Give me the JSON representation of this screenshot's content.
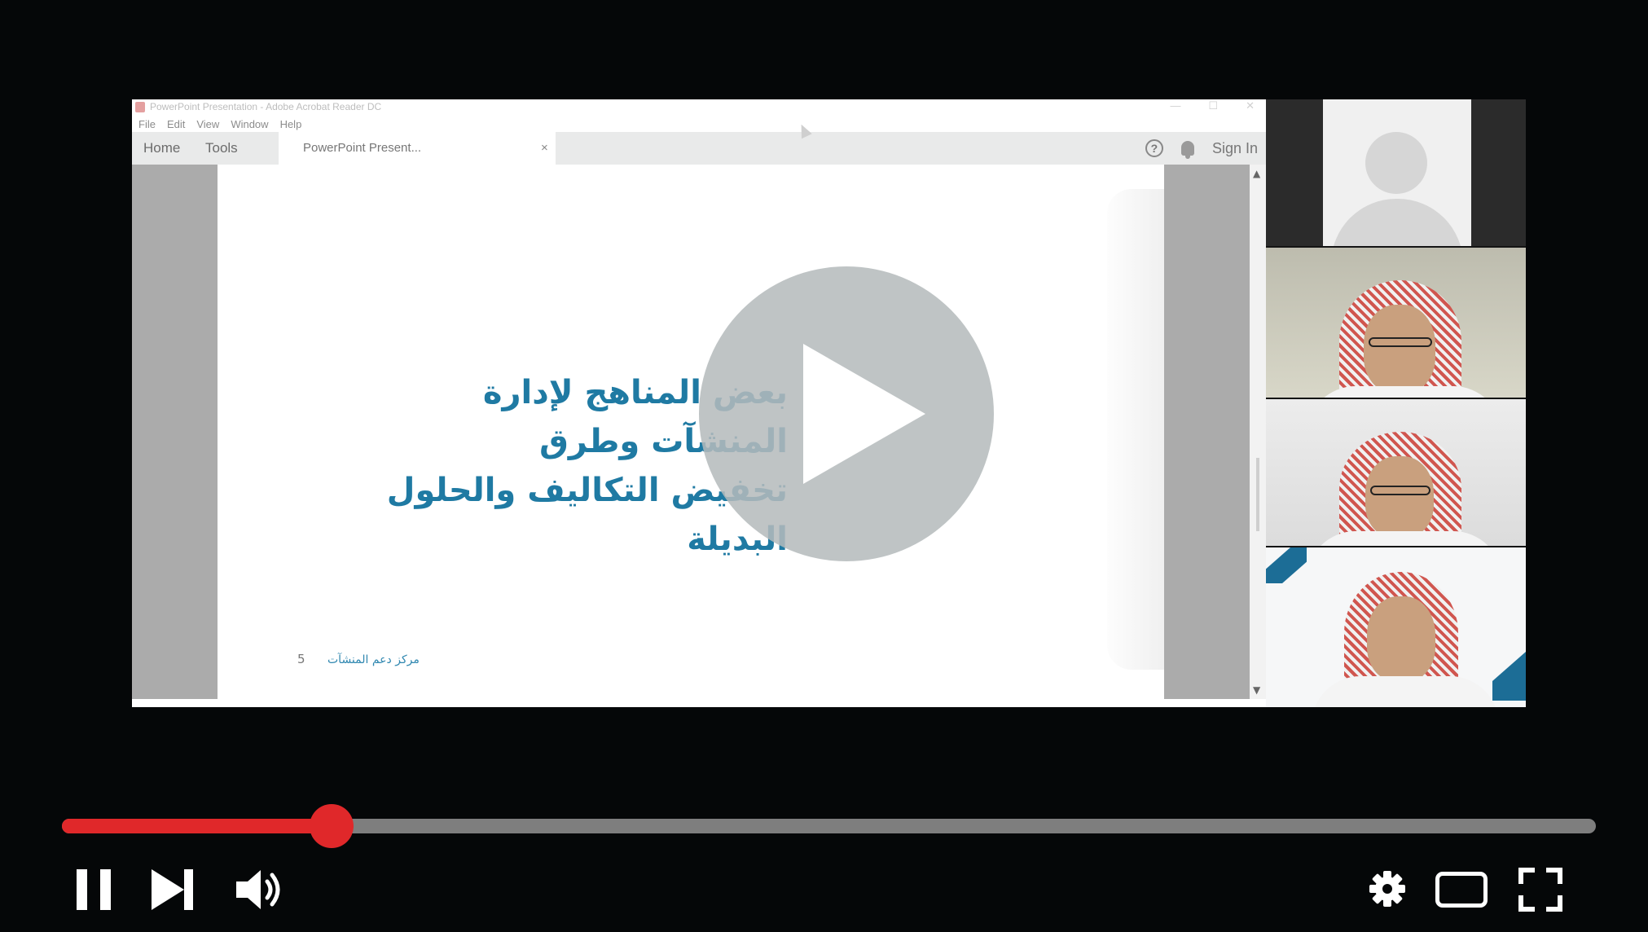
{
  "window": {
    "title": "PowerPoint Presentation - Adobe Acrobat Reader DC",
    "controls": [
      "—",
      "☐",
      "✕"
    ]
  },
  "menu": [
    "File",
    "Edit",
    "View",
    "Window",
    "Help"
  ],
  "toolbar": {
    "home_label": "Home",
    "tools_label": "Tools",
    "doc_tab_label": "PowerPoint Present...",
    "doc_tab_close": "×",
    "help_glyph": "?",
    "sign_in_label": "Sign In"
  },
  "slide": {
    "title_line1": "بعض المناهج لإدارة المنشآت وطرق",
    "title_line2": "تخفيض التكاليف والحلول البديلة",
    "footer_org": "مركز دعم المنشآت",
    "page_number": "5"
  },
  "participants": [
    {
      "type": "avatar-placeholder"
    },
    {
      "type": "camera"
    },
    {
      "type": "camera"
    },
    {
      "type": "camera"
    }
  ],
  "player": {
    "progress_fraction": 0.176,
    "accent_color": "#e0282a",
    "icons": [
      "big-play-icon",
      "pause-icon",
      "next-icon",
      "volume-icon",
      "gear-icon",
      "theater-icon",
      "fullscreen-icon"
    ]
  }
}
